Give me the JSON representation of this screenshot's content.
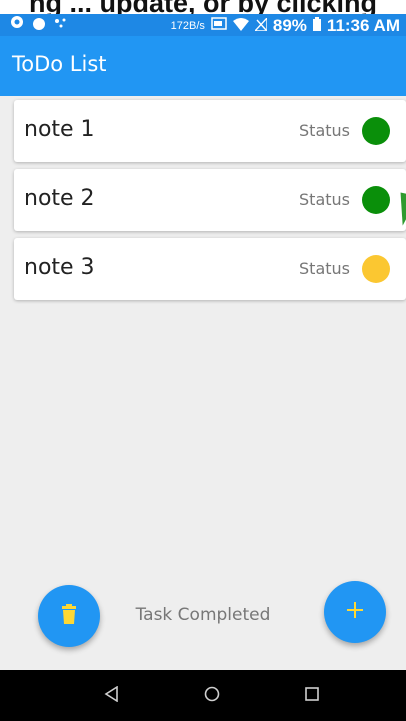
{
  "caption": {
    "text": "ng ... update, or by clicking"
  },
  "status_bar": {
    "network_speed": "172B/s",
    "battery": "89%",
    "time": "11:36 AM"
  },
  "app_bar": {
    "title": "ToDo List"
  },
  "notes": [
    {
      "title": "note 1",
      "status_label": "Status",
      "status_color": "#0a8f0a"
    },
    {
      "title": "note 2",
      "status_label": "Status",
      "status_color": "#0a8f0a"
    },
    {
      "title": "note 3",
      "status_label": "Status",
      "status_color": "#fbc731"
    }
  ],
  "footer": {
    "text": "Task Completed"
  },
  "colors": {
    "primary": "#2196f3",
    "status_bar": "#1e88e5",
    "trash_icon": "#fdd835",
    "plus_icon": "#fdd835"
  },
  "icons": {
    "delete": "trash-icon",
    "add": "plus-icon",
    "nav_back": "back-triangle-icon",
    "nav_home": "home-circle-icon",
    "nav_recents": "recents-square-icon"
  }
}
